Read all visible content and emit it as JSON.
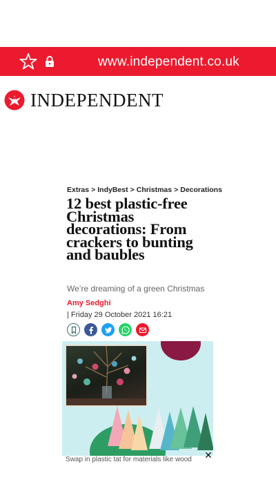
{
  "browser": {
    "url": "www.independent.co.uk",
    "icons": {
      "star": "star-outline-icon",
      "lock": "lock-icon"
    },
    "accent": "#ec1a2e"
  },
  "brand": {
    "wordmark": "INDEPENDENT"
  },
  "article": {
    "breadcrumb": [
      "Extras",
      ">",
      "IndyBest",
      ">",
      "Christmas",
      ">",
      "Decorations"
    ],
    "headline": "12 best plastic-free Christmas decorations: From crackers to bunting and baubles",
    "standfirst": "We’re dreaming of a green Christmas",
    "author": "Amy Sedghi",
    "date": "| Friday 29 October 2021 16:21",
    "share": [
      {
        "icon": "bookmark-icon",
        "color": "#ffffff"
      },
      {
        "icon": "facebook-icon",
        "color": "#3b5998"
      },
      {
        "icon": "twitter-icon",
        "color": "#1da1f2"
      },
      {
        "icon": "whatsapp-icon",
        "color": "#25d366"
      },
      {
        "icon": "email-icon",
        "color": "#ec1a2e"
      }
    ],
    "caption": "Swap in plastic tat for materials like wood"
  }
}
